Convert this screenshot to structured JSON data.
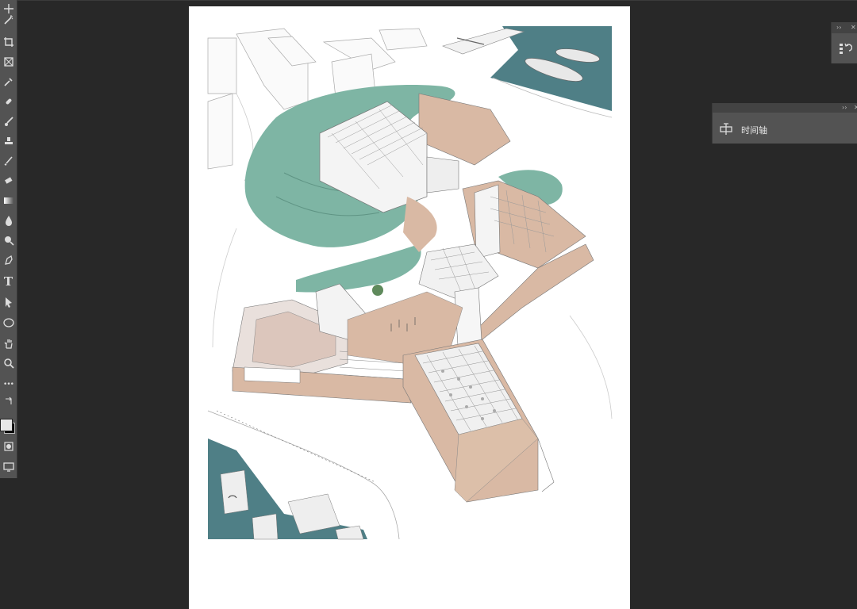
{
  "app": {
    "colors": {
      "workspace": "#282828",
      "panel": "#535353",
      "panel_header": "#434343",
      "water": "#4f7f86",
      "green": "#7eb5a4",
      "terrace": "#d9b9a4"
    }
  },
  "toolbar": {
    "tools": [
      {
        "name": "magic-wand-icon"
      },
      {
        "name": "crop-icon"
      },
      {
        "name": "frame-icon"
      },
      {
        "name": "eyedropper-icon"
      },
      {
        "name": "healing-brush-icon"
      },
      {
        "name": "brush-icon"
      },
      {
        "name": "stamp-icon"
      },
      {
        "name": "history-brush-icon"
      },
      {
        "name": "eraser-icon"
      },
      {
        "name": "gradient-icon"
      },
      {
        "name": "blur-icon"
      },
      {
        "name": "dodge-icon"
      },
      {
        "name": "pen-icon"
      },
      {
        "name": "type-icon",
        "glyph": "T"
      },
      {
        "name": "path-selection-icon"
      },
      {
        "name": "ellipse-icon"
      },
      {
        "name": "hand-icon"
      },
      {
        "name": "zoom-icon"
      },
      {
        "name": "more-tools-icon",
        "glyph": "•••"
      }
    ]
  },
  "panels": {
    "mini": {
      "collapse": "››",
      "close": "✕"
    },
    "timeline": {
      "collapse": "››",
      "close": "✕",
      "label": "时间轴"
    }
  }
}
